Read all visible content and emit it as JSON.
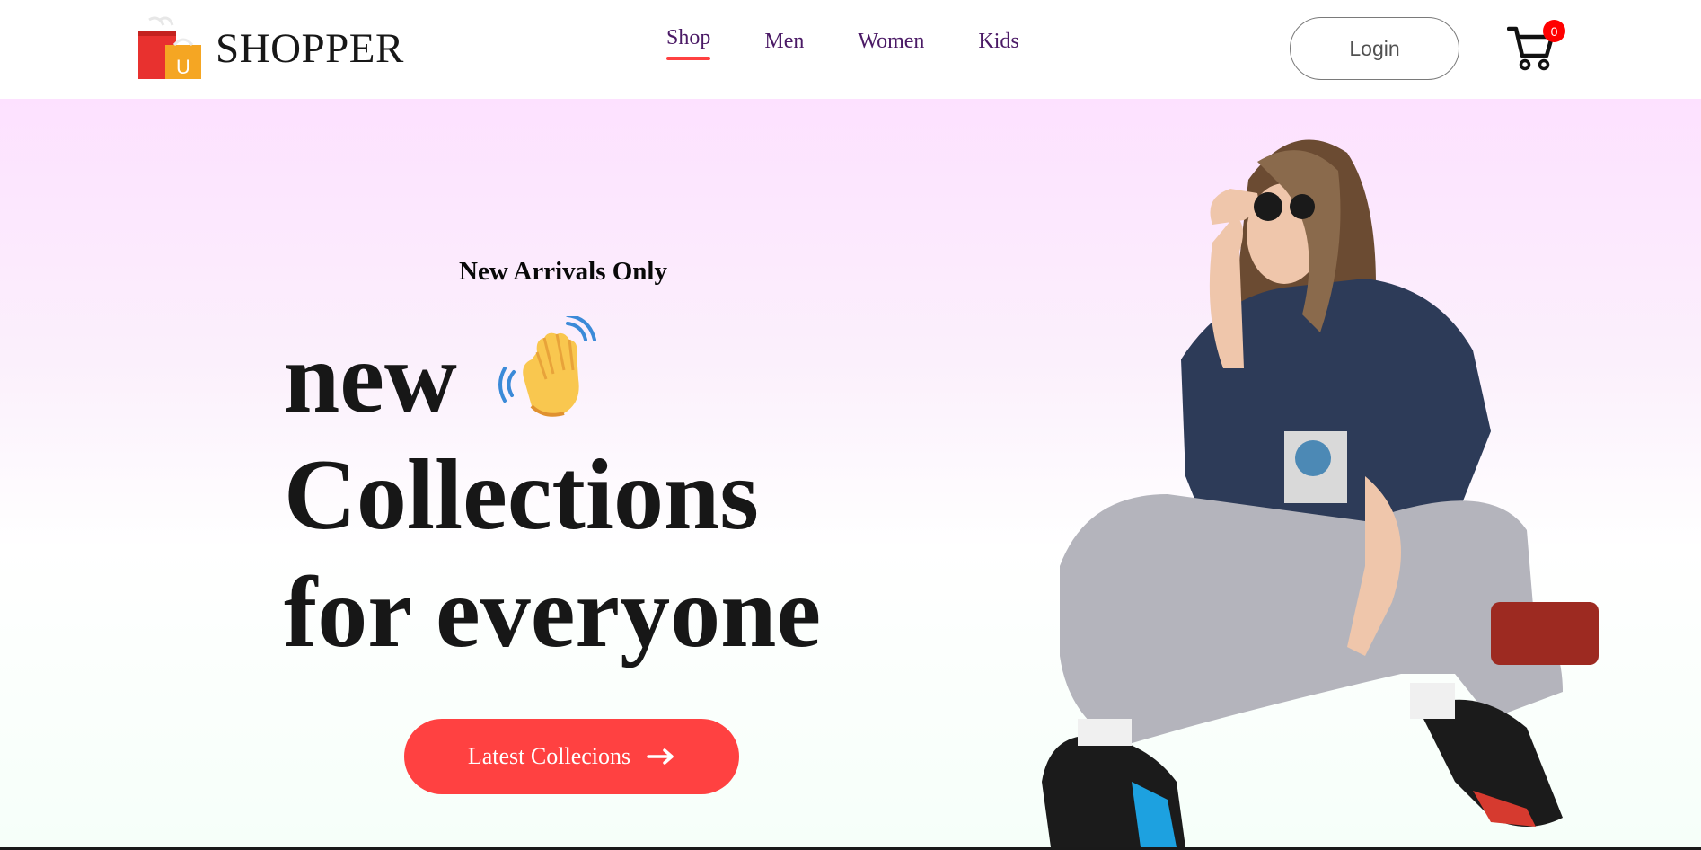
{
  "brand": {
    "name": "SHOPPER",
    "logo_letter": "U",
    "logo_icon": "shopping-bags-icon"
  },
  "nav": {
    "items": [
      {
        "label": "Shop",
        "active": true
      },
      {
        "label": "Men",
        "active": false
      },
      {
        "label": "Women",
        "active": false
      },
      {
        "label": "Kids",
        "active": false
      }
    ]
  },
  "header": {
    "login_label": "Login",
    "cart_count": "0",
    "cart_icon": "cart-icon"
  },
  "hero": {
    "eyebrow": "New Arrivals Only",
    "line1": "new",
    "line2": "Collections",
    "line3": "for everyone",
    "hand_icon": "waving-hand-icon",
    "button_label": "Latest Collecions",
    "button_icon": "arrow-right-icon",
    "image": "woman-crouching-hero-image"
  },
  "colors": {
    "accent": "#ff4141",
    "nav_text": "#4b1a66",
    "hero_gradient_top": "#fde1ff",
    "hero_gradient_bottom": "#f6fff9",
    "badge": "#ff0000"
  }
}
